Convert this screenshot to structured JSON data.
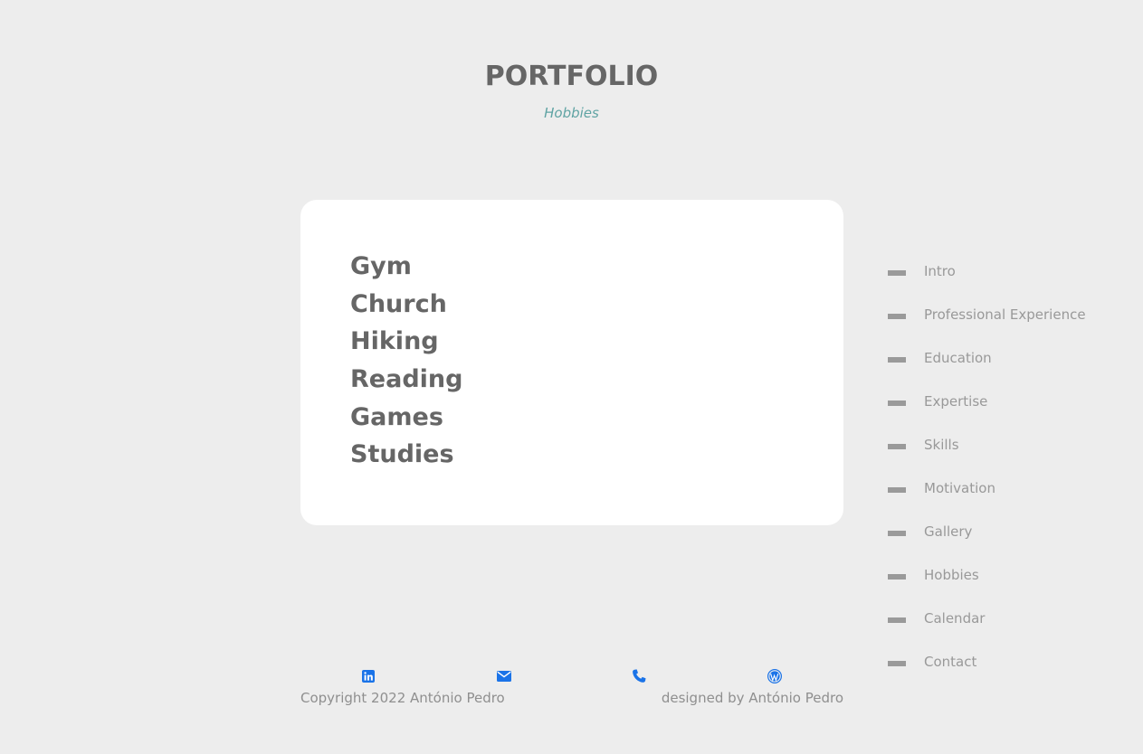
{
  "header": {
    "title": "PORTFOLIO",
    "subtitle": "Hobbies"
  },
  "hobbies": [
    "Gym",
    "Church",
    "Hiking",
    "Reading",
    "Games",
    "Studies"
  ],
  "nav": {
    "items": [
      {
        "label": "Intro"
      },
      {
        "label": "Professional Experience"
      },
      {
        "label": "Education"
      },
      {
        "label": "Expertise"
      },
      {
        "label": "Skills"
      },
      {
        "label": "Motivation"
      },
      {
        "label": "Gallery"
      },
      {
        "label": "Hobbies"
      },
      {
        "label": "Calendar"
      },
      {
        "label": "Contact"
      }
    ]
  },
  "footer": {
    "icons": [
      "linkedin-icon",
      "email-icon",
      "phone-icon",
      "wordpress-icon"
    ],
    "copyright": "Copyright 2022 António Pedro",
    "designed_by": "designed by António Pedro"
  },
  "colors": {
    "background": "#ededed",
    "card": "#ffffff",
    "accent_subtitle": "#5fa3a3",
    "icon_blue": "#1a73e8",
    "text": "#666666",
    "muted": "#999999"
  }
}
